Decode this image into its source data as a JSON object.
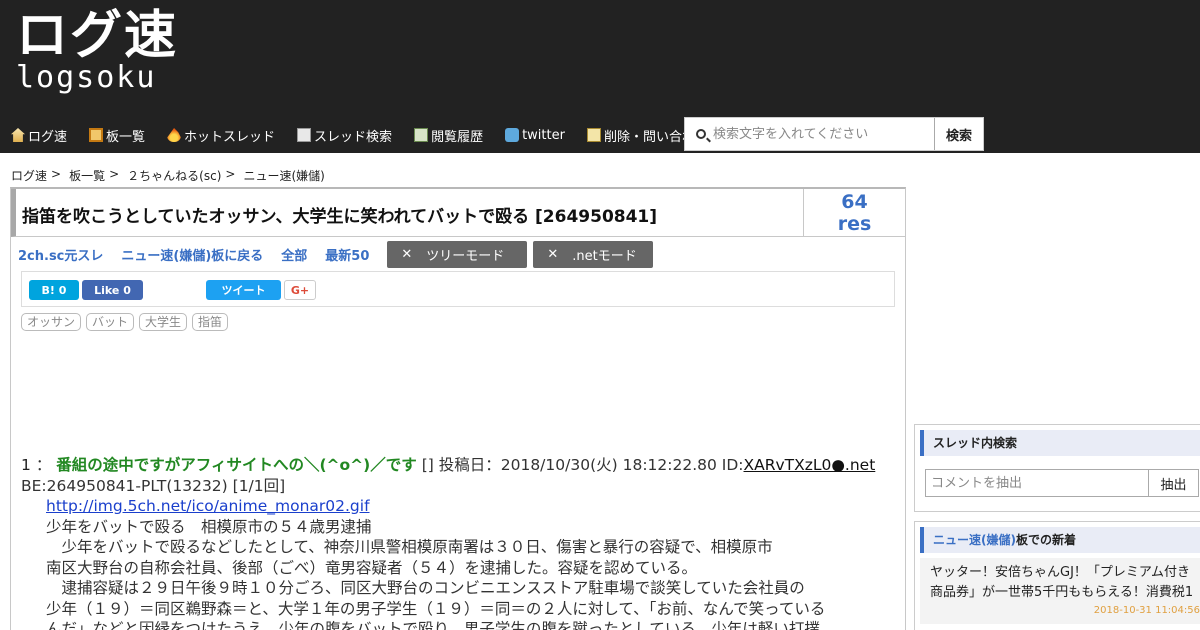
{
  "header": {
    "logo_main": "ログ速",
    "logo_sub": "logsoku"
  },
  "nav": {
    "items": [
      {
        "label": "ログ速",
        "icon": "home-icon"
      },
      {
        "label": "板一覧",
        "icon": "board-icon"
      },
      {
        "label": "ホットスレッド",
        "icon": "fire-icon"
      },
      {
        "label": "スレッド検索",
        "icon": "search-thread-icon"
      },
      {
        "label": "閲覧履歴",
        "icon": "history-icon"
      },
      {
        "label": "twitter",
        "icon": "twitter-icon"
      },
      {
        "label": "削除・問い合わせ",
        "icon": "mail-icon"
      }
    ]
  },
  "search": {
    "placeholder": "検索文字を入れてください",
    "button": "検索"
  },
  "breadcrumb": [
    "ログ速",
    "板一覧",
    "２ちゃんねる(sc)",
    "ニュー速(嫌儲)"
  ],
  "breadcrumb_sep": ">",
  "thread": {
    "title": "指笛を吹こうとしていたオッサン、大学生に笑われてバットで殴る [264950841]",
    "res_count": "64",
    "res_label": "res"
  },
  "links": [
    "2ch.sc元スレ",
    "ニュー速(嫌儲)板に戻る",
    "全部",
    "最新50"
  ],
  "modes": {
    "tree": "ツリーモード",
    "net": ".netモード",
    "close_glyph": "✕"
  },
  "share": {
    "hatena": "B! 0",
    "facebook": "Like 0",
    "tweet": "ツイート",
    "gplus": "G+"
  },
  "tags": [
    "オッサン",
    "バット",
    "大学生",
    "指笛"
  ],
  "post": {
    "number": "1",
    "colon": "：",
    "name": "番組の途中ですがアフィサイトへの＼(^o^)／です",
    "mail": "[]",
    "date_label": "投稿日：2018/10/30(火) 18:12:22.80 ID:",
    "id": "XARvTXzL0●.net",
    "be": "BE:264950841-PLT(13232) [1/1回]",
    "link": "http://img.5ch.net/ico/anime_monar02.gif",
    "lines": [
      "少年をバットで殴る　相模原市の５４歳男逮捕",
      "　少年をバットで殴るなどしたとして、神奈川県警相模原南署は３０日、傷害と暴行の容疑で、相模原市",
      "南区大野台の自称会社員、後部（ごべ）竜男容疑者（５４）を逮捕した。容疑を認めている。",
      "　逮捕容疑は２９日午後９時１０分ごろ、同区大野台のコンビニエンスストア駐車場で談笑していた会社員の",
      "少年（１９）＝同区鵜野森＝と、大学１年の男子学生（１９）＝同＝の２人に対して、「お前、なんで笑っている",
      "んだ」などと因縁をつけたうえ、少年の腹をバットで殴り、男子学生の腹を蹴ったとしている。少年は軽い打撲"
    ]
  },
  "sidebar": {
    "search_title": "スレッド内検索",
    "extract_placeholder": "コメントを抽出",
    "extract_button": "抽出",
    "new_board": "ニュー速(嫌儲)",
    "new_suffix": "板での新着",
    "news": [
      {
        "title": "ヤッター！安倍ちゃんGJ！「プレミアム付き商品券」が一世帯5千円ももらえる！消費税1",
        "date": "2018-10-31 11:04:56"
      }
    ]
  }
}
